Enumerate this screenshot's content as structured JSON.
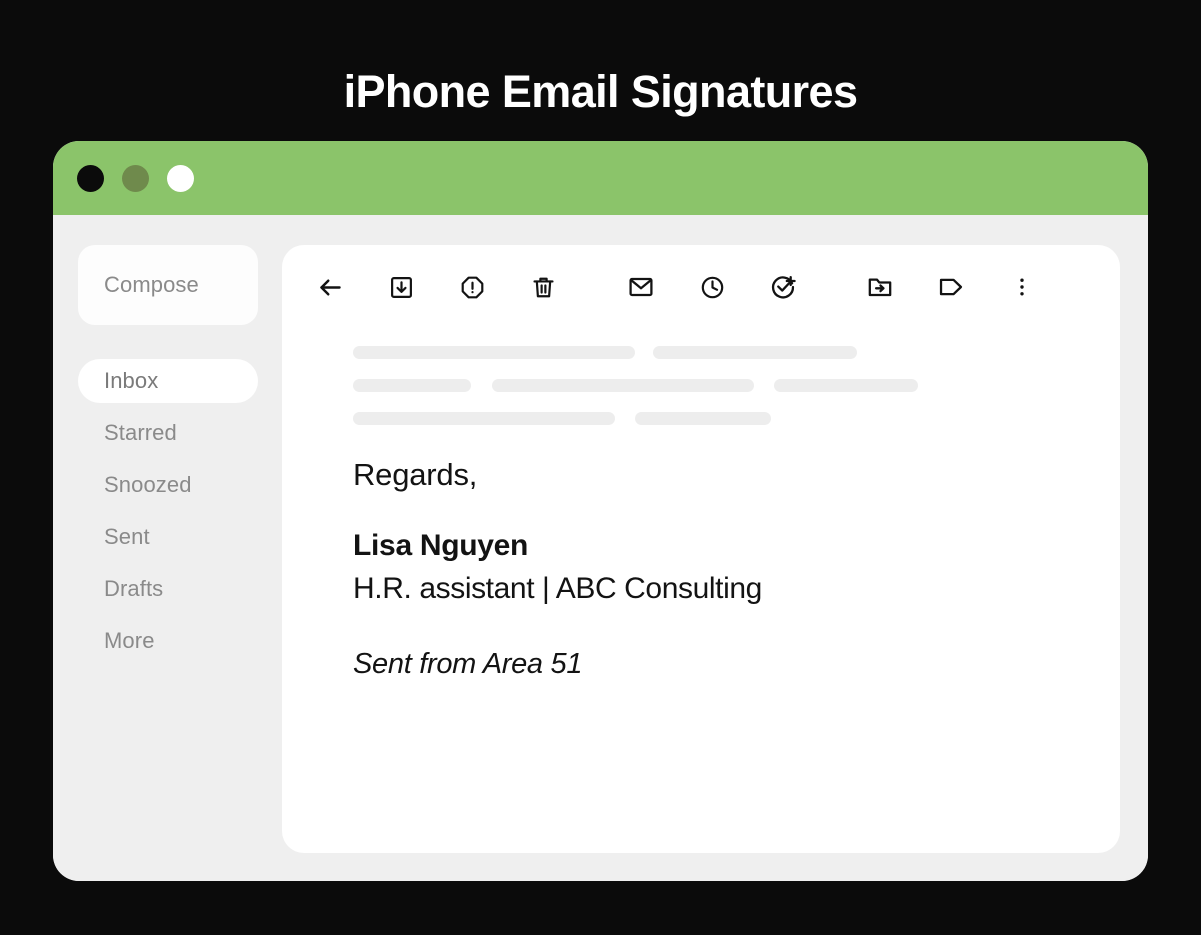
{
  "page": {
    "title": "iPhone Email Signatures",
    "backdrop_color": "#0B0B0B",
    "accent_color": "#8BC46A"
  },
  "window": {
    "titlebar": {
      "color": "#8BC46A",
      "traffic_lights": [
        {
          "name": "close",
          "color": "#0B0B0B"
        },
        {
          "name": "minimize",
          "color": "#6F8A4C"
        },
        {
          "name": "maximize",
          "color": "#FFFFFF"
        }
      ]
    }
  },
  "sidebar": {
    "compose_label": "Compose",
    "items": [
      {
        "label": "Inbox",
        "active": true
      },
      {
        "label": "Starred",
        "active": false
      },
      {
        "label": "Snoozed",
        "active": false
      },
      {
        "label": "Sent",
        "active": false
      },
      {
        "label": "Drafts",
        "active": false
      },
      {
        "label": "More",
        "active": false
      }
    ]
  },
  "toolbar": {
    "buttons": [
      {
        "name": "back-arrow-icon",
        "label": "Back"
      },
      {
        "name": "archive-icon",
        "label": "Archive"
      },
      {
        "name": "report-spam-icon",
        "label": "Report spam"
      },
      {
        "name": "delete-trash-icon",
        "label": "Delete"
      },
      {
        "name": "mark-unread-envelope-icon",
        "label": "Mark as unread"
      },
      {
        "name": "snooze-clock-icon",
        "label": "Snooze"
      },
      {
        "name": "add-to-tasks-icon",
        "label": "Add to tasks"
      },
      {
        "name": "move-to-folder-icon",
        "label": "Move to"
      },
      {
        "name": "label-tag-icon",
        "label": "Labels"
      },
      {
        "name": "more-options-icon",
        "label": "More"
      }
    ]
  },
  "message": {
    "skeleton_rows": [
      [
        282,
        18,
        204
      ],
      [
        118,
        21,
        262,
        20,
        144
      ],
      [
        262,
        20,
        136
      ]
    ],
    "skeleton_color": "#EDEDED",
    "signature": {
      "regards": "Regards,",
      "name": "Lisa Nguyen",
      "role": "H.R. assistant | ABC Consulting",
      "sent_from": "Sent from Area 51"
    }
  }
}
